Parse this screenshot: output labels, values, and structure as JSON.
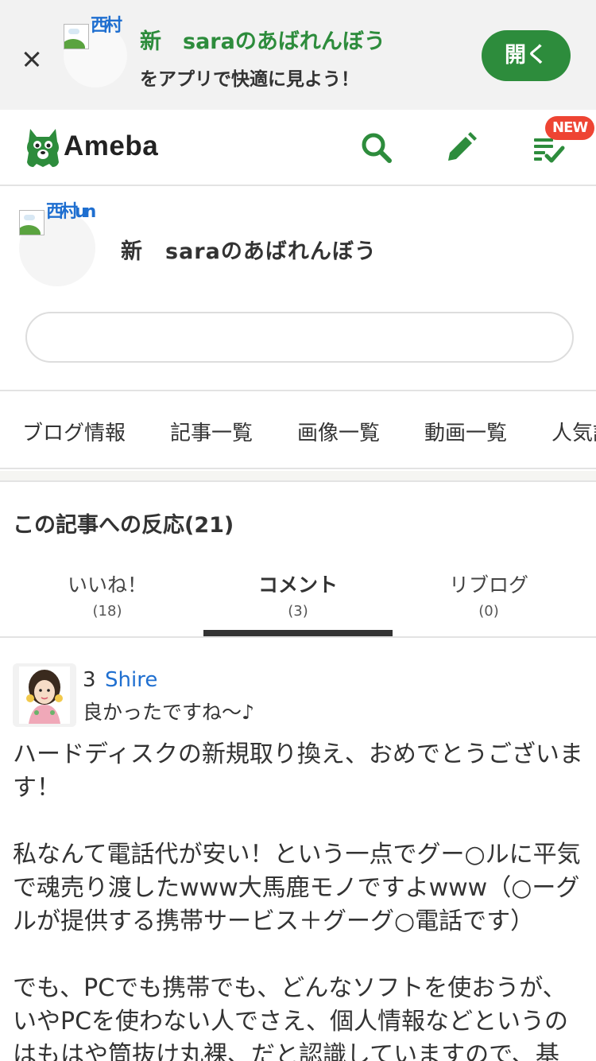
{
  "banner": {
    "title": "新　saraのあばれんぼう",
    "subtitle": "をアプリで快適に見よう！",
    "open_label": "開く",
    "avatar_alt": "西村"
  },
  "header": {
    "logo_text": "Ameba",
    "new_badge": "NEW",
    "icons": [
      "search-icon",
      "pencil-icon",
      "checklist-icon"
    ]
  },
  "profile": {
    "avatar_alt": "西村un",
    "blog_name": "新　saraのあばれんぼう",
    "search_placeholder": ""
  },
  "blog_nav": {
    "items": [
      "ブログ情報",
      "記事一覧",
      "画像一覧",
      "動画一覧",
      "人気記"
    ]
  },
  "reactions": {
    "title": "この記事への反応(21)",
    "tabs": [
      {
        "label": "いいね！",
        "count": "(18)"
      },
      {
        "label": "コメント",
        "count": "(3)"
      },
      {
        "label": "リブログ",
        "count": "(0)"
      }
    ],
    "active_tab": "コメント"
  },
  "comment": {
    "number": "3",
    "author": "Shire",
    "title": "良かったですね～♪",
    "body": "ハードディスクの新規取り換え、おめでとうございます！\n\n私なんて電話代が安い！という一点でグー○ルに平気で魂売り渡したwww大馬鹿モノですよwww（○ーグルが提供する携帯サービス＋グーグ○電話です）\n\nでも、PCでも携帯でも、どんなソフトを使おうが、いやPCを使わない人でさえ、個人情報などというのはもはや筒抜け丸裸、だと認識していますので、基"
  },
  "colors": {
    "brand_green": "#2d8c3c",
    "link_blue": "#1f6fd0",
    "badge_red": "#ee4433"
  }
}
